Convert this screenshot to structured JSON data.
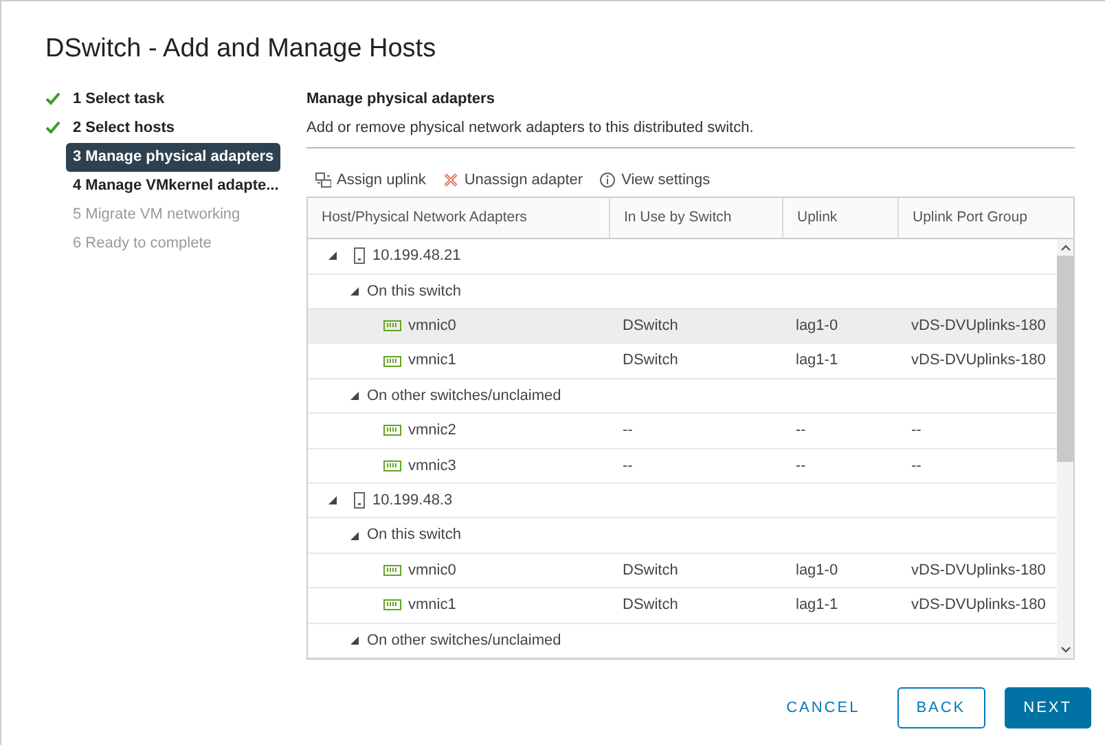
{
  "window": {
    "title": "DSwitch - Add and Manage Hosts"
  },
  "steps": [
    {
      "label": "1 Select task",
      "done": true,
      "selected": false,
      "disabled": false
    },
    {
      "label": "2 Select hosts",
      "done": true,
      "selected": false,
      "disabled": false
    },
    {
      "label": "3 Manage physical adapters",
      "done": false,
      "selected": true,
      "disabled": false
    },
    {
      "label": "4 Manage VMkernel adapte...",
      "done": false,
      "selected": false,
      "disabled": false
    },
    {
      "label": "5 Migrate VM networking",
      "done": false,
      "selected": false,
      "disabled": true
    },
    {
      "label": "6 Ready to complete",
      "done": false,
      "selected": false,
      "disabled": true
    }
  ],
  "page": {
    "title": "Manage physical adapters",
    "subtitle": "Add or remove physical network adapters to this distributed switch."
  },
  "toolbar": [
    {
      "kind": "assign",
      "label": "Assign uplink"
    },
    {
      "kind": "unassign",
      "label": "Unassign adapter"
    },
    {
      "kind": "info",
      "label": "View settings"
    }
  ],
  "table": {
    "columns": [
      "Host/Physical Network Adapters",
      "In Use by Switch",
      "Uplink",
      "Uplink Port Group"
    ],
    "rows": [
      {
        "kind": "host",
        "name": "10.199.48.21",
        "expanded": true,
        "children": [
          {
            "kind": "group",
            "name": "On this switch",
            "expanded": true,
            "children": [
              {
                "kind": "adapter",
                "name": "vmnic0",
                "switch": "DSwitch",
                "uplink": "lag1-0",
                "port_group": "vDS-DVUplinks-180",
                "selected": true
              },
              {
                "kind": "adapter",
                "name": "vmnic1",
                "switch": "DSwitch",
                "uplink": "lag1-1",
                "port_group": "vDS-DVUplinks-180",
                "selected": false
              }
            ]
          },
          {
            "kind": "group",
            "name": "On other switches/unclaimed",
            "expanded": true,
            "children": [
              {
                "kind": "adapter",
                "name": "vmnic2",
                "switch": "--",
                "uplink": "--",
                "port_group": "--",
                "selected": false
              },
              {
                "kind": "adapter",
                "name": "vmnic3",
                "switch": "--",
                "uplink": "--",
                "port_group": "--",
                "selected": false
              }
            ]
          }
        ]
      },
      {
        "kind": "host",
        "name": "10.199.48.3",
        "expanded": true,
        "children": [
          {
            "kind": "group",
            "name": "On this switch",
            "expanded": true,
            "children": [
              {
                "kind": "adapter",
                "name": "vmnic0",
                "switch": "DSwitch",
                "uplink": "lag1-0",
                "port_group": "vDS-DVUplinks-180",
                "selected": false
              },
              {
                "kind": "adapter",
                "name": "vmnic1",
                "switch": "DSwitch",
                "uplink": "lag1-1",
                "port_group": "vDS-DVUplinks-180",
                "selected": false
              }
            ]
          },
          {
            "kind": "group",
            "name": "On other switches/unclaimed",
            "expanded": true
          }
        ]
      }
    ]
  },
  "buttons": [
    {
      "kind": "link",
      "label": "CANCEL"
    },
    {
      "kind": "outline",
      "label": "BACK"
    },
    {
      "kind": "primary",
      "label": "NEXT"
    }
  ]
}
